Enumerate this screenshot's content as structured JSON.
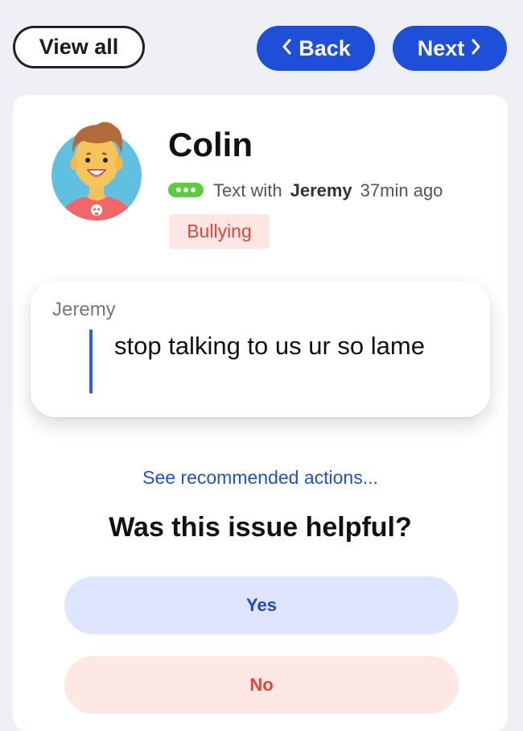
{
  "nav": {
    "view_all": "View all",
    "back": "Back",
    "next": "Next"
  },
  "profile": {
    "name": "Colin",
    "channel": "Text with",
    "contact": "Jeremy",
    "time_ago": "37min ago",
    "tag": "Bullying"
  },
  "message": {
    "sender": "Jeremy",
    "text": "stop talking to us ur so lame"
  },
  "actions": {
    "recommend_link": "See recommended actions...",
    "question": "Was this issue helpful?",
    "yes": "Yes",
    "no": "No"
  },
  "colors": {
    "primary": "#1f4fd8",
    "danger": "#e0463a",
    "chat_green": "#5ccb3c"
  }
}
